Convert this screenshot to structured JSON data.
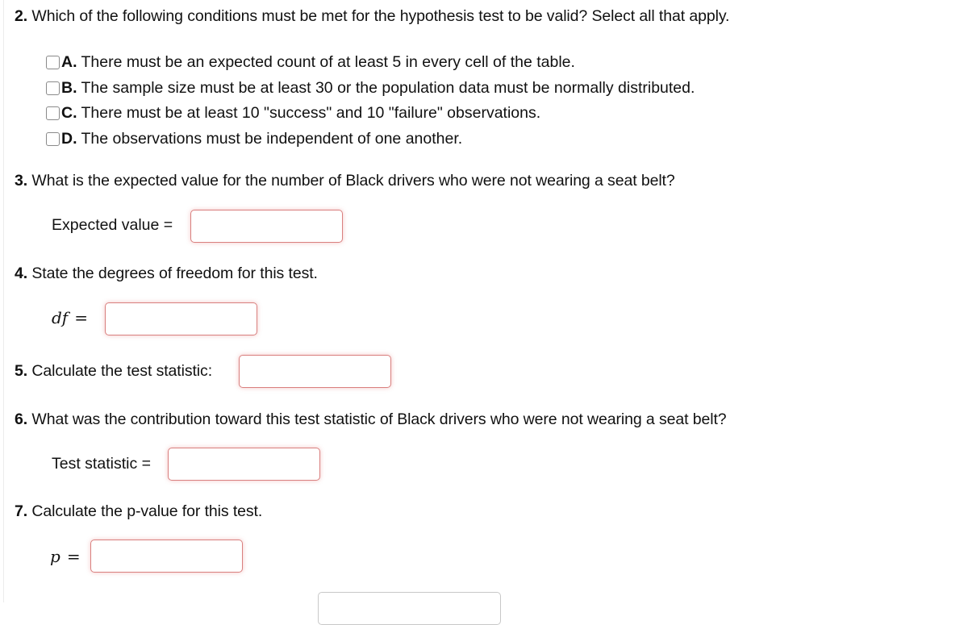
{
  "questions": {
    "q2": {
      "number": "2.",
      "text": " Which of the following conditions must be met for the hypothesis test to be valid? Select all that apply.",
      "options": [
        {
          "letter": "A.",
          "text": "There must be an expected count of at least 5 in every cell of the table.",
          "checked": false
        },
        {
          "letter": "B.",
          "text": "The sample size must be at least 30 or the population data must be normally distributed.",
          "checked": false
        },
        {
          "letter": "C.",
          "text": "There must be at least 10 \"success\" and 10 \"failure\" observations.",
          "checked": false
        },
        {
          "letter": "D.",
          "text": "The observations must be independent of one another.",
          "checked": false
        }
      ]
    },
    "q3": {
      "number": "3.",
      "text": " What is the expected value for the number of Black drivers who were not wearing a seat belt?",
      "label": "Expected value =",
      "value": ""
    },
    "q4": {
      "number": "4.",
      "text": " State the degrees of freedom for this test.",
      "label": "df",
      "eq": "=",
      "value": ""
    },
    "q5": {
      "number": "5.",
      "text": " Calculate the test statistic:",
      "value": ""
    },
    "q6": {
      "number": "6.",
      "text": " What was the contribution toward this test statistic of Black drivers who were not wearing a seat belt?",
      "label": "Test statistic =",
      "value": ""
    },
    "q7": {
      "number": "7.",
      "text": " Calculate the p-value for this test.",
      "label": "p",
      "eq": "=",
      "value": ""
    }
  },
  "colors": {
    "invalid_border": "#d9807f",
    "checkbox_border": "#8a8a8a"
  }
}
